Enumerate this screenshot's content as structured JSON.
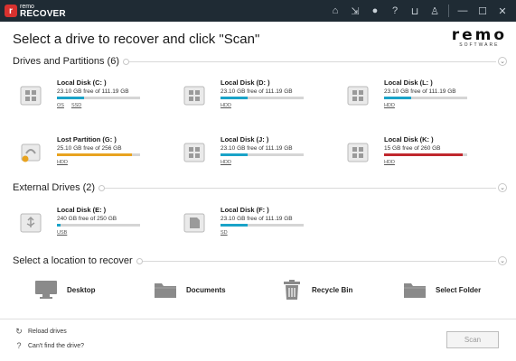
{
  "app": {
    "logo_small": "remo",
    "logo_big": "RECOVER",
    "logo_glyph": "r",
    "toolbar_icons": [
      "home-icon",
      "export-icon",
      "globe-icon",
      "help-icon",
      "cart-icon",
      "user-icon",
      "minimize-icon",
      "maximize-icon",
      "close-icon"
    ]
  },
  "heading": "Select a drive to recover and click \"Scan\"",
  "brand": {
    "name": "remo",
    "tagline": "SOFTWARE"
  },
  "sections": {
    "drives": "Drives and Partitions (6)",
    "external": "External Drives (2)",
    "locations": "Select a location to recover"
  },
  "drives": [
    {
      "name": "Local Disk (C: )",
      "size": "23.10 GB free of 111.19 GB",
      "fill": 0.33,
      "color": "#1aa3c8",
      "tags": [
        "OS",
        "SSD"
      ]
    },
    {
      "name": "Local Disk (D: )",
      "size": "23.10 GB free of 111.19 GB",
      "fill": 0.33,
      "color": "#1aa3c8",
      "tags": [
        "HDD"
      ]
    },
    {
      "name": "Local Disk (L: )",
      "size": "23.10 GB free of 111.19 GB",
      "fill": 0.33,
      "color": "#1aa3c8",
      "tags": [
        "HDD"
      ]
    },
    {
      "name": "Lost Partition (G: )",
      "size": "25.10 GB free of 256 GB",
      "fill": 0.9,
      "color": "#e8a31f",
      "tags": [
        "HDD"
      ]
    },
    {
      "name": "Local Disk (J: )",
      "size": "23.10 GB free of 111.19 GB",
      "fill": 0.33,
      "color": "#1aa3c8",
      "tags": [
        "HDD"
      ]
    },
    {
      "name": "Local Disk (K: )",
      "size": "15 GB free of 260 GB",
      "fill": 0.95,
      "color": "#c0272d",
      "tags": [
        "HDD"
      ]
    }
  ],
  "external": [
    {
      "name": "Local Disk (E: )",
      "size": "240 GB free of 250 GB",
      "fill": 0.04,
      "color": "#1aa3c8",
      "tags": [
        "USB"
      ]
    },
    {
      "name": "Local Disk (F: )",
      "size": "23.10 GB free of 111.19 GB",
      "fill": 0.33,
      "color": "#1aa3c8",
      "tags": [
        "SD"
      ]
    }
  ],
  "locations": [
    "Desktop",
    "Documents",
    "Recycle Bin",
    "Select Folder"
  ],
  "footer": {
    "reload": "Reload drives",
    "cant_find": "Can't find the drive?"
  },
  "scan_label": "Scan"
}
